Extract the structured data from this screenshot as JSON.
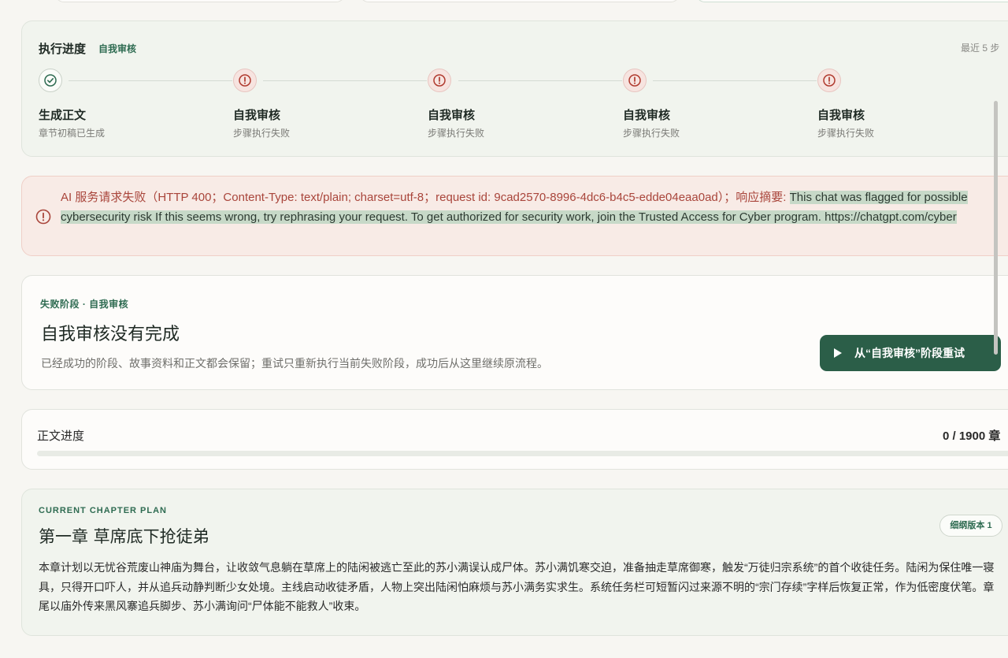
{
  "progress": {
    "title": "执行进度",
    "current_badge": "自我审核",
    "recent": "最近 5 步",
    "steps": [
      {
        "label": "生成正文",
        "desc": "章节初稿已生成",
        "status": "success",
        "icon": "check-circle-icon"
      },
      {
        "label": "自我审核",
        "desc": "步骤执行失败",
        "status": "error",
        "icon": "alert-circle-icon"
      },
      {
        "label": "自我审核",
        "desc": "步骤执行失败",
        "status": "error",
        "icon": "alert-circle-icon"
      },
      {
        "label": "自我审核",
        "desc": "步骤执行失败",
        "status": "error",
        "icon": "alert-circle-icon"
      },
      {
        "label": "自我审核",
        "desc": "步骤执行失败",
        "status": "error",
        "icon": "alert-circle-icon"
      }
    ]
  },
  "error": {
    "icon": "alert-circle-icon",
    "prefix": "AI 服务请求失败（HTTP 400；Content-Type: text/plain; charset=utf-8；request id: 9cad2570-8996-4dc6-b4c5-edde04eaa0ad）；响应摘要: ",
    "highlighted": "This chat was flagged for possible cybersecurity risk If this seems wrong, try rephrasing your request. To get authorized for security work, join the Trusted Access for Cyber program. https://chatgpt.com/cyber"
  },
  "failed_stage": {
    "stage_line": "失败阶段 · 自我审核",
    "title": "自我审核没有完成",
    "description": "已经成功的阶段、故事资料和正文都会保留；重试只重新执行当前失败阶段，成功后从这里继续原流程。",
    "retry_label": "从“自我审核”阶段重试",
    "retry_icon": "play-icon"
  },
  "text_progress": {
    "label": "正文进度",
    "count": "0 / 1900 章",
    "completed": 0,
    "total": 1900
  },
  "chapter_plan": {
    "eyebrow": "CURRENT CHAPTER PLAN",
    "title": "第一章 草席底下抢徒弟",
    "version": "细纲版本 1",
    "body": "本章计划以无忧谷荒废山神庙为舞台，让收敛气息躺在草席上的陆闲被逃亡至此的苏小满误认成尸体。苏小满饥寒交迫，准备抽走草席御寒，触发“万徒归宗系统”的首个收徒任务。陆闲为保住唯一寝具，只得开口吓人，并从追兵动静判断少女处境。主线启动收徒矛盾，人物上突出陆闲怕麻烦与苏小满务实求生。系统任务栏可短暂闪过来源不明的“宗门存续”字样后恢复正常，作为低密度伏笔。章尾以庙外传来黑风寨追兵脚步、苏小满询问“尸体能不能救人”收束。"
  },
  "colors": {
    "accent": "#2e6b51",
    "error_text": "#a9453b",
    "error_bg": "#f8ebe6",
    "highlight": "#c7d9c8",
    "button_bg": "#2b5e48"
  }
}
